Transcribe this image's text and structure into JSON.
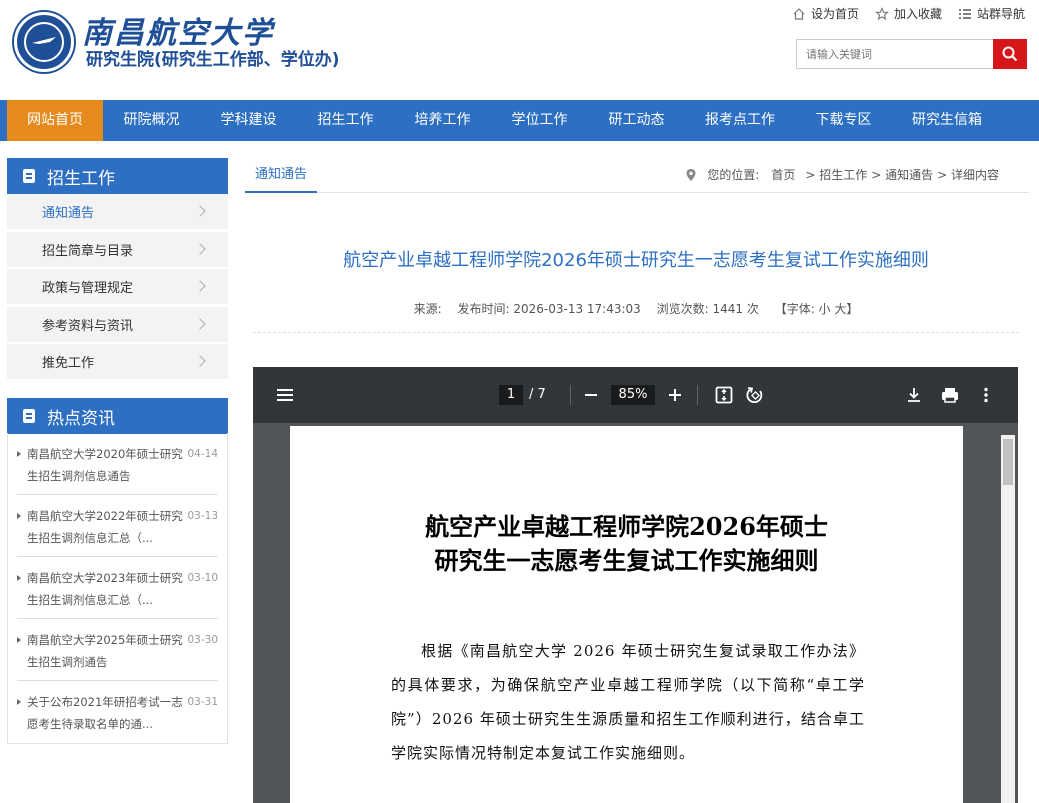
{
  "header": {
    "school_name": "南昌航空大学",
    "dept_name": "研究生院(研究生工作部、学位办)",
    "top_links": [
      "设为首页",
      "加入收藏",
      "站群导航"
    ],
    "search_placeholder": "请输入关键词"
  },
  "nav": {
    "items": [
      "网站首页",
      "研院概况",
      "学科建设",
      "招生工作",
      "培养工作",
      "学位工作",
      "研工动态",
      "报考点工作",
      "下载专区",
      "研究生信箱"
    ],
    "active": "网站首页"
  },
  "sidebar": {
    "section_title": "招生工作",
    "menu": [
      "通知通告",
      "招生简章与目录",
      "政策与管理规定",
      "参考资料与资讯",
      "推免工作"
    ],
    "hot_title": "热点资讯",
    "hot": [
      {
        "title": "南昌航空大学2020年硕士研究生招生调剂信息通告",
        "date": "04-14"
      },
      {
        "title": "南昌航空大学2022年硕士研究生招生调剂信息汇总（...",
        "date": "03-13"
      },
      {
        "title": "南昌航空大学2023年硕士研究生招生调剂信息汇总（...",
        "date": "03-10"
      },
      {
        "title": "南昌航空大学2025年硕士研究生招生调剂通告",
        "date": "03-30"
      },
      {
        "title": "关于公布2021年研招考试一志愿考生待录取名单的通...",
        "date": "03-31"
      }
    ]
  },
  "content": {
    "tab": "通知通告",
    "breadcrumb": [
      "您的位置:",
      "首页",
      "> 招生工作",
      "> 通知通告",
      "> 详细内容"
    ],
    "title": "航空产业卓越工程师学院2026年硕士研究生一志愿考生复试工作实施细则",
    "meta": {
      "source": "来源:",
      "publish": "发布时间: 2026-03-13 17:43:03",
      "views": "浏览次数: 1441 次",
      "font": "【字体: 小 大】"
    }
  },
  "pdf": {
    "page": "1",
    "total": "/ 7",
    "zoom": "85%",
    "doc_title_line1": "航空产业卓越工程师学院2026年硕士",
    "doc_title_line2": "研究生一志愿考生复试工作实施细则",
    "body": "根据《南昌航空大学 2026 年硕士研究生复试录取工作办法》的具体要求，为确保航空产业卓越工程师学院（以下简称“卓工学院”）2026 年硕士研究生生源质量和招生工作顺利进行，结合卓工学院实际情况特制定本复试工作实施细则。"
  },
  "colors": {
    "primary_blue": "#2d6fc2",
    "nav_active": "#e68a1e",
    "search_button": "#d7161a",
    "pdf_toolbar": "#323639"
  }
}
